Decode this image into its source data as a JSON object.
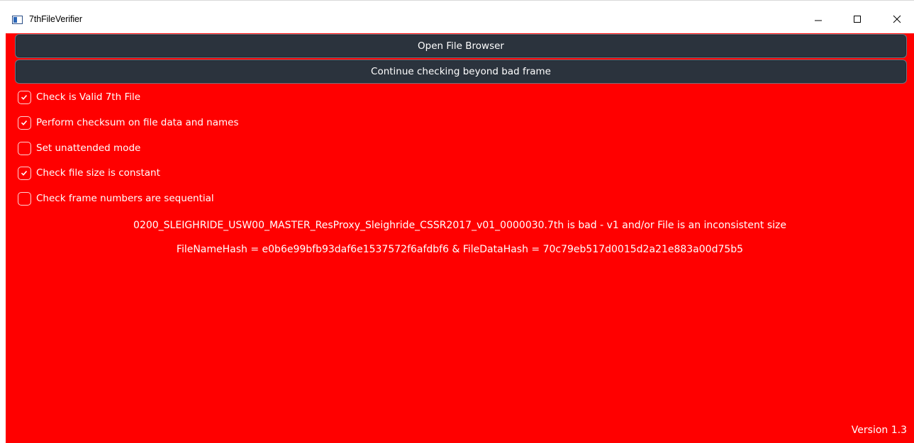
{
  "window": {
    "title": "7thFileVerifier",
    "icon": "app-window-icon",
    "controls": [
      "minimize-icon",
      "maximize-icon",
      "close-icon"
    ]
  },
  "colors": {
    "client_background": "#ff0000",
    "button_background": "#2b333d",
    "text": "#ffffff"
  },
  "buttons": {
    "open_file_browser": "Open File Browser",
    "continue_checking": "Continue checking beyond bad frame"
  },
  "options": [
    {
      "label": "Check is Valid 7th File",
      "checked": true
    },
    {
      "label": "Perform checksum on file data and names",
      "checked": true
    },
    {
      "label": "Set unattended mode",
      "checked": false
    },
    {
      "label": "Check file size is constant",
      "checked": true
    },
    {
      "label": "Check frame numbers are sequential",
      "checked": false
    }
  ],
  "status": {
    "result": "0200_SLEIGHRIDE_USW00_MASTER_ResProxy_Sleighride_CSSR2017_v01_0000030.7th is bad - v1 and/or File is an inconsistent size",
    "hashes": "FileNameHash = e0b6e99bfb93daf6e1537572f6afdbf6 & FileDataHash = 70c79eb517d0015d2a21e883a00d75b5"
  },
  "version": "Version 1.3"
}
